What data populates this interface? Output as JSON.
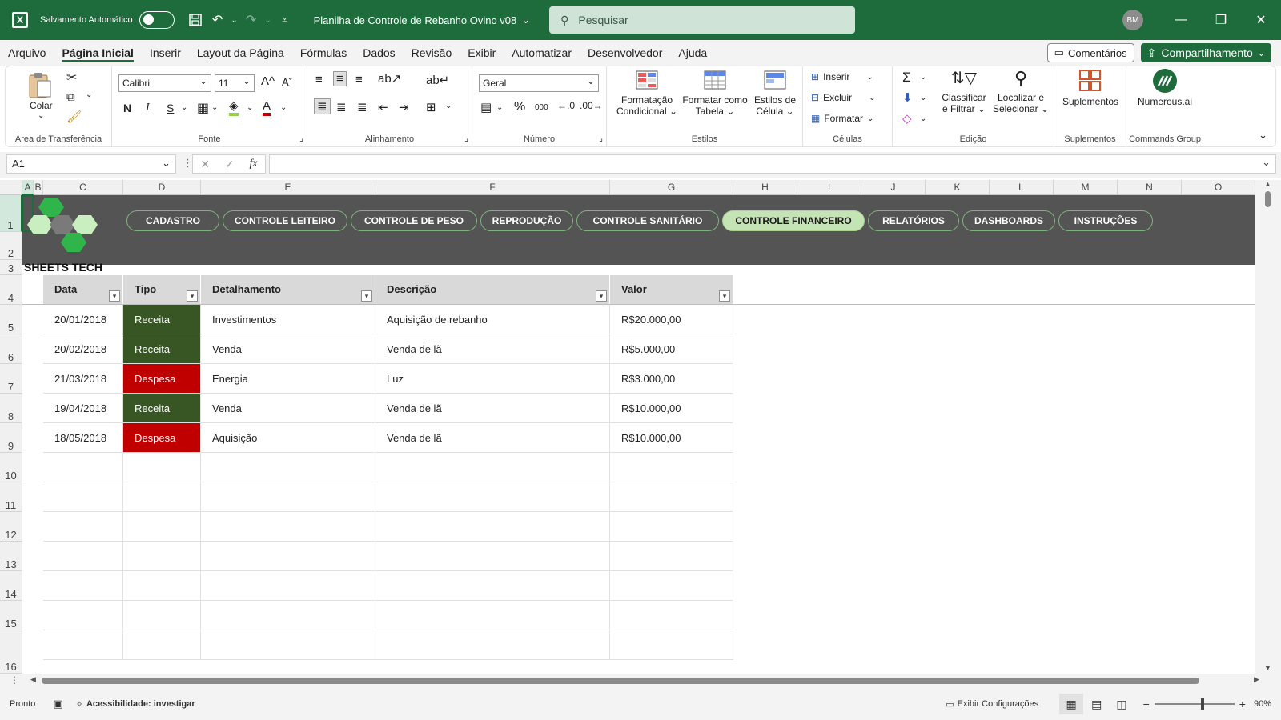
{
  "titlebar": {
    "autosave_label": "Salvamento Automático",
    "file_title": "Planilha de Controle de Rebanho Ovino v08",
    "search_placeholder": "Pesquisar",
    "avatar": "BM"
  },
  "menu": {
    "items": [
      "Arquivo",
      "Página Inicial",
      "Inserir",
      "Layout da Página",
      "Fórmulas",
      "Dados",
      "Revisão",
      "Exibir",
      "Automatizar",
      "Desenvolvedor",
      "Ajuda"
    ],
    "comments": "Comentários",
    "share": "Compartilhamento"
  },
  "ribbon": {
    "clipboard": {
      "paste": "Colar",
      "label": "Área de Transferência"
    },
    "font": {
      "name": "Calibri",
      "size": "11",
      "label": "Fonte",
      "bold": "N",
      "italic": "I",
      "underline": "S"
    },
    "alignment": {
      "label": "Alinhamento"
    },
    "number": {
      "format": "Geral",
      "label": "Número",
      "percent": "%",
      "thousands": "000"
    },
    "styles": {
      "conditional_line1": "Formatação",
      "conditional_line2": "Condicional",
      "table_line1": "Formatar como",
      "table_line2": "Tabela",
      "cell_line1": "Estilos de",
      "cell_line2": "Célula",
      "label": "Estilos"
    },
    "cells": {
      "insert": "Inserir",
      "delete": "Excluir",
      "format": "Formatar",
      "label": "Células"
    },
    "editing": {
      "sort_line1": "Classificar",
      "sort_line2": "e Filtrar",
      "find_line1": "Localizar e",
      "find_line2": "Selecionar",
      "label": "Edição"
    },
    "addins": {
      "button": "Suplementos",
      "label": "Suplementos"
    },
    "commands": {
      "button": "Numerous.ai",
      "label": "Commands Group"
    }
  },
  "formula_bar": {
    "name_box": "A1",
    "fx": "fx",
    "formula": ""
  },
  "columns": [
    "A",
    "B",
    "C",
    "D",
    "E",
    "F",
    "G",
    "H",
    "I",
    "J",
    "K",
    "L",
    "M",
    "N",
    "O"
  ],
  "rows": [
    "1",
    "2",
    "3",
    "4",
    "5",
    "6",
    "7",
    "8",
    "9",
    "10",
    "11",
    "12",
    "13",
    "14",
    "15",
    "16"
  ],
  "nav_buttons": [
    "CADASTRO",
    "CONTROLE LEITEIRO",
    "CONTROLE DE PESO",
    "REPRODUÇÃO",
    "CONTROLE SANITÁRIO",
    "CONTROLE FINANCEIRO",
    "RELATÓRIOS",
    "DASHBOARDS",
    "INSTRUÇÕES"
  ],
  "active_nav": "CONTROLE FINANCEIRO",
  "brand": "SHEETS TECH",
  "table": {
    "headers": [
      "Data",
      "Tipo",
      "Detalhamento",
      "Descrição",
      "Valor"
    ],
    "rows": [
      {
        "data": "20/01/2018",
        "tipo": "Receita",
        "detalhamento": "Investimentos",
        "descricao": "Aquisição de rebanho",
        "valor": "R$20.000,00"
      },
      {
        "data": "20/02/2018",
        "tipo": "Receita",
        "detalhamento": "Venda",
        "descricao": "Venda de lã",
        "valor": "R$5.000,00"
      },
      {
        "data": "21/03/2018",
        "tipo": "Despesa",
        "detalhamento": "Energia",
        "descricao": "Luz",
        "valor": "R$3.000,00"
      },
      {
        "data": "19/04/2018",
        "tipo": "Receita",
        "detalhamento": "Venda",
        "descricao": "Venda de lã",
        "valor": "R$10.000,00"
      },
      {
        "data": "18/05/2018",
        "tipo": "Despesa",
        "detalhamento": "Aquisição",
        "descricao": "Venda de lã",
        "valor": "R$10.000,00"
      }
    ]
  },
  "colors": {
    "excel_green": "#1e6b3c",
    "receita": "#375623",
    "despesa": "#c00000",
    "banner": "#545454",
    "active_nav": "#c5e4b5"
  },
  "statusbar": {
    "ready": "Pronto",
    "accessibility": "Acessibilidade: investigar",
    "display_settings": "Exibir Configurações",
    "zoom": "90%"
  }
}
